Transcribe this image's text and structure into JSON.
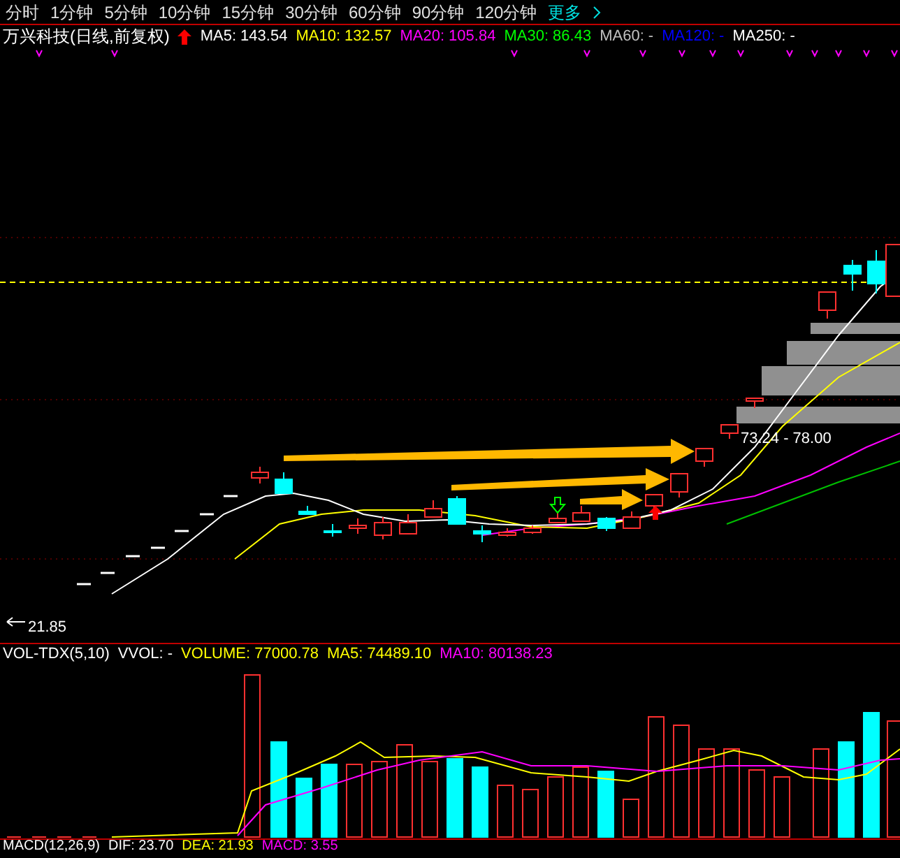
{
  "period_tabs": [
    {
      "label": "分时"
    },
    {
      "label": "1分钟"
    },
    {
      "label": "5分钟"
    },
    {
      "label": "10分钟"
    },
    {
      "label": "15分钟"
    },
    {
      "label": "30分钟"
    },
    {
      "label": "60分钟"
    },
    {
      "label": "90分钟"
    },
    {
      "label": "120分钟"
    }
  ],
  "more_link": {
    "label": "更多"
  },
  "title_bar": {
    "title": "万兴科技(日线,前复权)",
    "indicators": [
      {
        "text": "MA5: 143.54",
        "color": "#ffffff"
      },
      {
        "text": "MA10: 132.57",
        "color": "#ffff00"
      },
      {
        "text": "MA20: 105.84",
        "color": "#ff00ff"
      },
      {
        "text": "MA30: 86.43",
        "color": "#00ff00"
      },
      {
        "text": "MA60: -",
        "color": "#c0c0c0"
      },
      {
        "text": "MA120: -",
        "color": "#0000ff"
      },
      {
        "text": "MA250: -",
        "color": "#ffffff"
      }
    ]
  },
  "price_chart": {
    "low_label": "21.85",
    "range_label": "73.24 - 78.00"
  },
  "volume_bar": {
    "title": "VOL-TDX(5,10)",
    "indicators": [
      {
        "text": "VVOL: -",
        "color": "#ffffff"
      },
      {
        "text": "VOLUME: 77000.78",
        "color": "#ffff00"
      },
      {
        "text": "MA5: 74489.10",
        "color": "#ffff00"
      },
      {
        "text": "MA10: 80138.23",
        "color": "#ff00ff"
      }
    ]
  },
  "macd_bar": {
    "title": "MACD(12,26,9)",
    "indicators": [
      {
        "text": "DIF: 23.70",
        "color": "#ffffff"
      },
      {
        "text": "DEA: 21.93",
        "color": "#ffff00"
      },
      {
        "text": "MACD: 3.55",
        "color": "#ff00ff"
      }
    ]
  }
}
